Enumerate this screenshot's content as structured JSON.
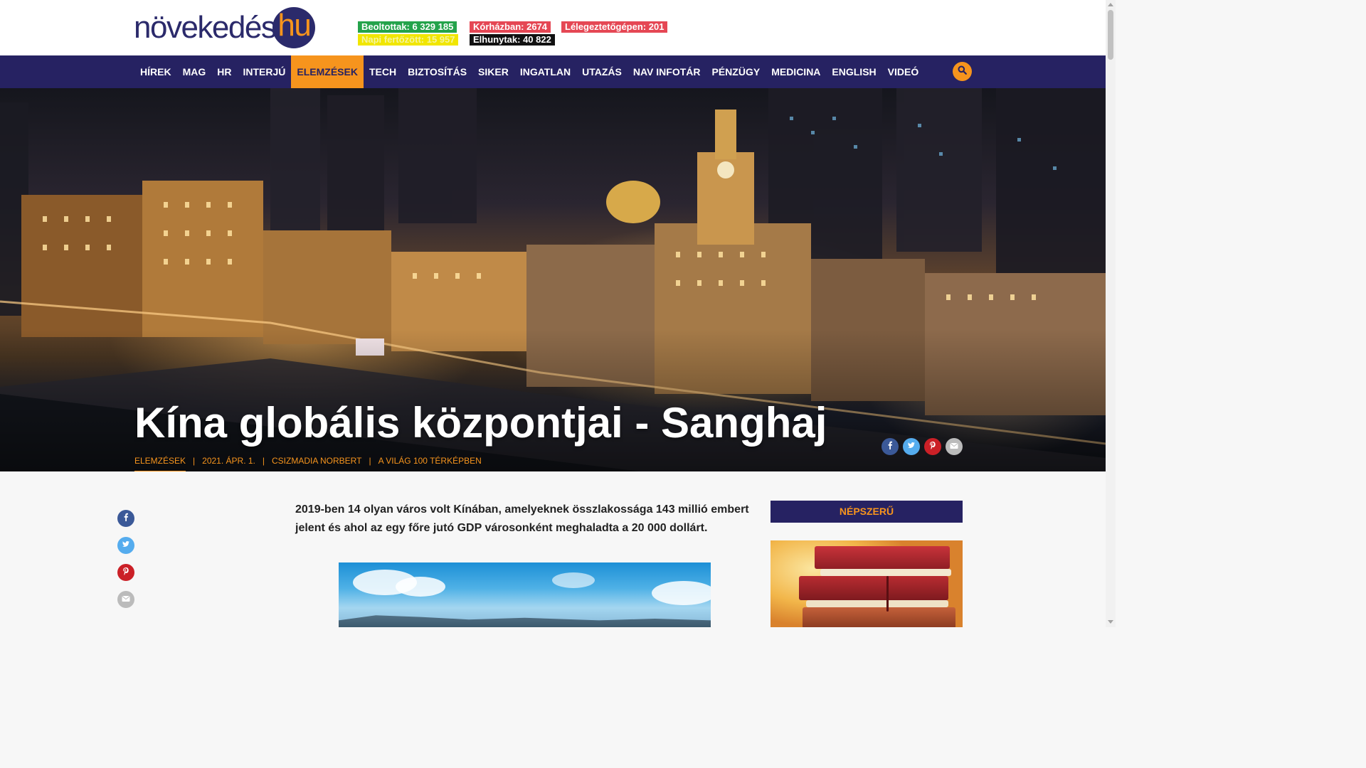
{
  "site": {
    "logo_word": "növekedés",
    "logo_circle": "hu"
  },
  "stats": {
    "vaccinated": "Beoltottak: 6 329 185",
    "hospital": "Kórházban: 2674",
    "ventilator": "Lélegeztetőgépen: 201",
    "daily": "Napi fertőzött: 15 957",
    "dead": "Elhunytak: 40 822"
  },
  "nav": {
    "items": [
      {
        "label": "HÍREK"
      },
      {
        "label": "MAG"
      },
      {
        "label": "HR"
      },
      {
        "label": "INTERJÚ"
      },
      {
        "label": "ELEMZÉSEK",
        "active": true
      },
      {
        "label": "TECH"
      },
      {
        "label": "BIZTOSÍTÁS"
      },
      {
        "label": "SIKER"
      },
      {
        "label": "INGATLAN"
      },
      {
        "label": "UTAZÁS"
      },
      {
        "label": "NAV INFOTÁR"
      },
      {
        "label": "PÉNZÜGY"
      },
      {
        "label": "MEDICINA"
      },
      {
        "label": "ENGLISH"
      },
      {
        "label": "VIDEÓ"
      }
    ],
    "search_icon": "search-icon"
  },
  "article": {
    "title": "Kína globális központjai - Sanghaj",
    "category": "ELEMZÉSEK",
    "date": "2021. ÁPR. 1.",
    "author": "CSIZMADIA NORBERT",
    "series": "A VILÁG 100 TÉRKÉPBEN",
    "separator": "|",
    "lead": "2019-ben 14 olyan város volt Kínában, amelyeknek összlakossága 143 millió embert jelent és ahol az egy főre jutó GDP városonként meghaladta a 20 000 dollárt."
  },
  "sidebar": {
    "heading": "NÉPSZERŰ"
  },
  "colors": {
    "navy": "#262262",
    "orange": "#f6941d",
    "green": "#24a34b",
    "red": "#e54754",
    "yellow": "#f1e600",
    "facebook": "#3b5998",
    "twitter": "#55acee",
    "pinterest": "#cb2027",
    "email": "#bbbbbb"
  },
  "share_icons": [
    "facebook-icon",
    "twitter-icon",
    "pinterest-icon",
    "email-icon"
  ]
}
